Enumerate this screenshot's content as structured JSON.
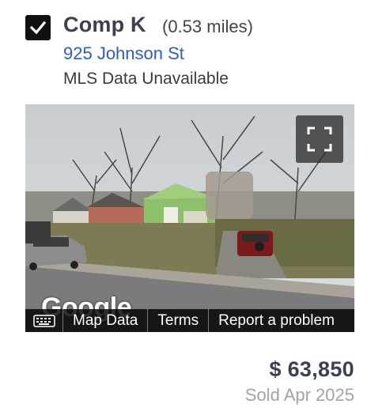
{
  "comp": {
    "checked": true,
    "title": "Comp K",
    "distance": "(0.53 miles)",
    "address": "925 Johnson St",
    "mls_status": "MLS Data Unavailable"
  },
  "streetview": {
    "logo_text": "Google",
    "attribution": {
      "keyboard_icon": "keyboard-icon",
      "map_data": "Map Data",
      "terms": "Terms",
      "report": "Report a problem"
    },
    "fullscreen_icon": "fullscreen-icon"
  },
  "sale": {
    "price": "$ 63,850",
    "date": "Sold Apr 2025"
  },
  "colors": {
    "title": "#3b4150",
    "link": "#2d5ebc",
    "muted": "#a3a3a3"
  }
}
